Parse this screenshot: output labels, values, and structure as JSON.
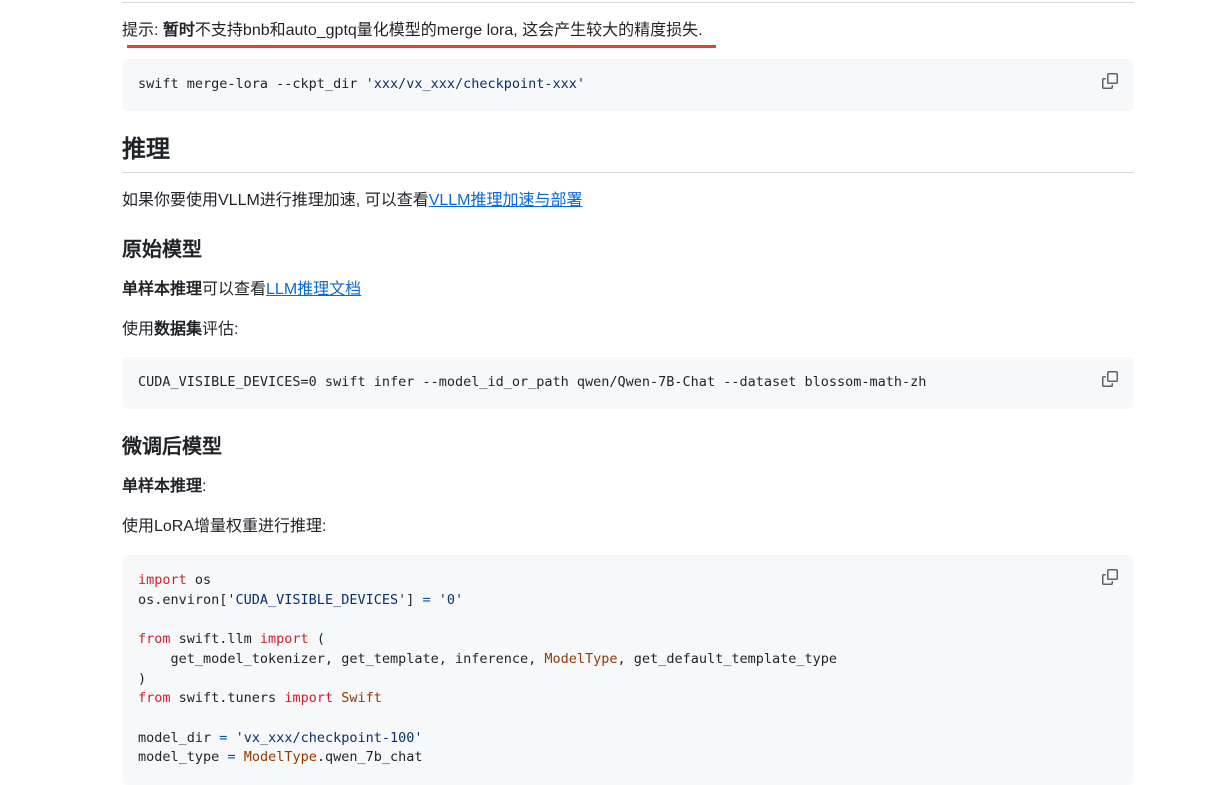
{
  "tip": {
    "prefix": "提示: ",
    "bold": "暂时",
    "rest": "不支持bnb和auto_gptq量化模型的merge lora, 这会产生较大的精度损失."
  },
  "merge_code": {
    "cmd": "swift merge-lora --ckpt_dir ",
    "arg": "'xxx/vx_xxx/checkpoint-xxx'"
  },
  "inference": {
    "heading": "推理",
    "intro_text": "如果你要使用VLLM进行推理加速, 可以查看",
    "intro_link": "VLLM推理加速与部署"
  },
  "original_model": {
    "heading": "原始模型",
    "single_bold": "单样本推理",
    "single_text": "可以查看",
    "single_link": "LLM推理文档",
    "dataset_prefix": "使用",
    "dataset_bold": "数据集",
    "dataset_suffix": "评估:",
    "code": "CUDA_VISIBLE_DEVICES=0 swift infer --model_id_or_path qwen/Qwen-7B-Chat --dataset blossom-math-zh"
  },
  "finetuned_model": {
    "heading": "微调后模型",
    "single_bold": "单样本推理",
    "single_suffix": ":",
    "lora_text": "使用LoRA增量权重进行推理:"
  },
  "python_code": {
    "l1_kw": "import",
    "l1_rest": " os",
    "l2_a": "os.environ[",
    "l2_str": "'CUDA_VISIBLE_DEVICES'",
    "l2_b": "] ",
    "l2_op": "=",
    "l2_c": " ",
    "l2_val": "'0'",
    "l4_kw1": "from",
    "l4_mid": " swift.llm ",
    "l4_kw2": "import",
    "l4_end": " (",
    "l5_a": "    get_model_tokenizer, get_template, inference, ",
    "l5_cls": "ModelType",
    "l5_b": ", get_default_template_type",
    "l6": ")",
    "l7_kw1": "from",
    "l7_mid": " swift.tuners ",
    "l7_kw2": "import",
    "l7_sp": " ",
    "l7_cls": "Swift",
    "l9_a": "model_dir ",
    "l9_op": "=",
    "l9_b": " ",
    "l9_str": "'vx_xxx/checkpoint-100'",
    "l10_a": "model_type ",
    "l10_op": "=",
    "l10_b": " ",
    "l10_cls": "ModelType",
    "l10_c": ".qwen_7b_chat"
  },
  "icons": {
    "copy": "copy-icon"
  },
  "colors": {
    "accent_underline": "#e0442c",
    "link": "#0969da",
    "keyword": "#cf222e",
    "string": "#0a3069",
    "class": "#953800",
    "code_bg": "#f6f8fa"
  }
}
